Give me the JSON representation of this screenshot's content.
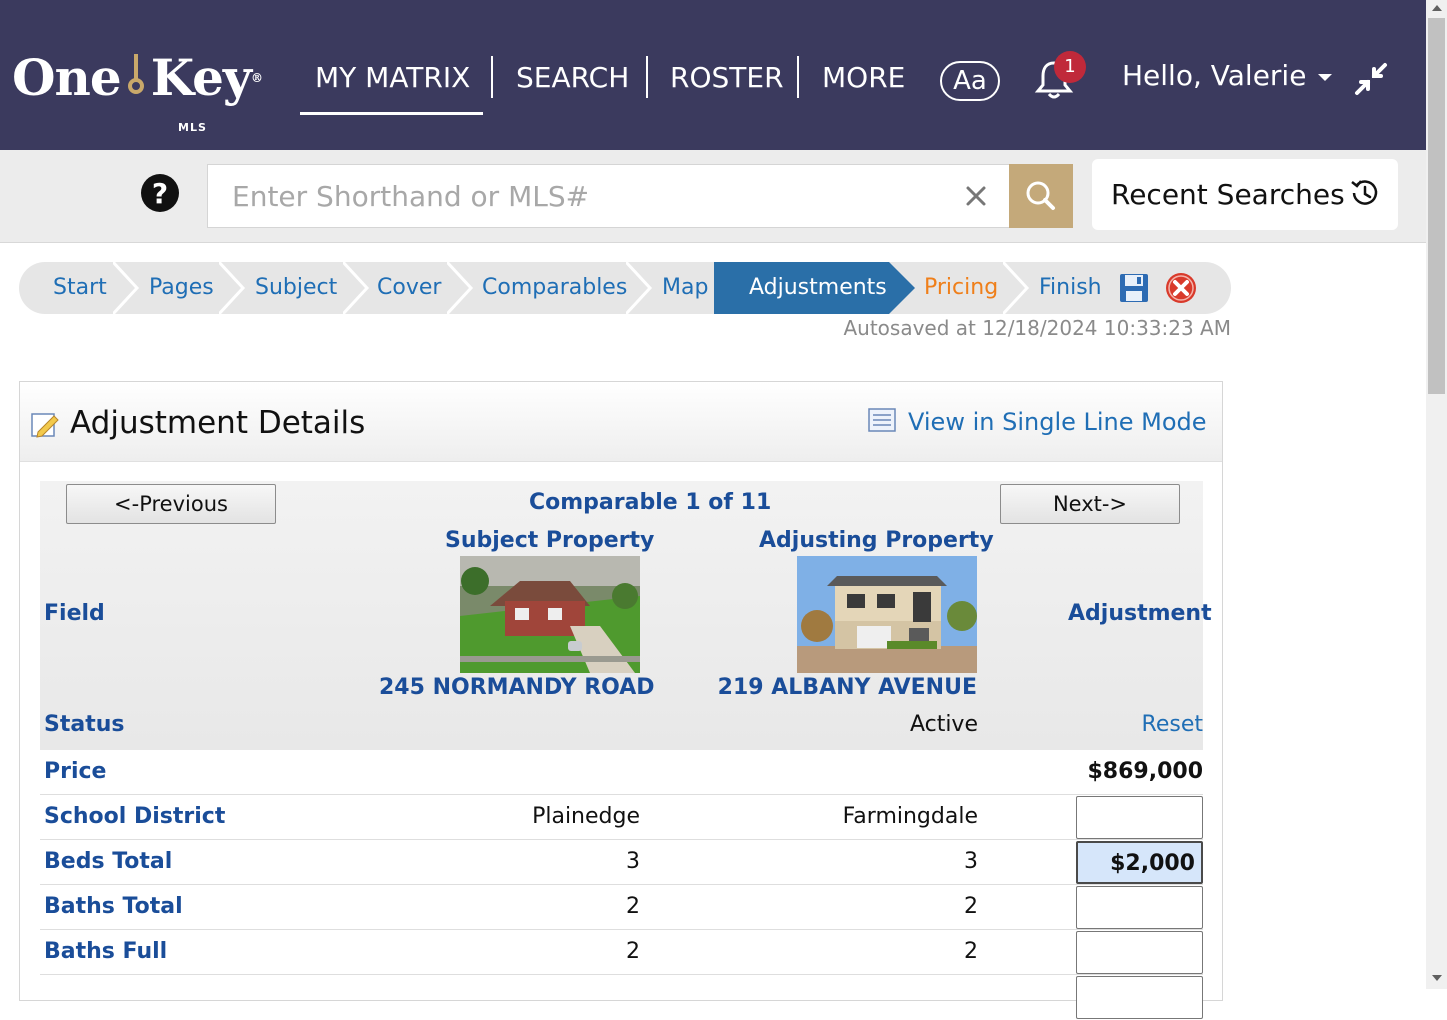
{
  "header": {
    "logo_text_left": "One",
    "logo_text_right": "Key",
    "logo_reg": "®",
    "logo_sub": "MLS",
    "nav": [
      "MY MATRIX",
      "SEARCH",
      "ROSTER",
      "MORE"
    ],
    "font_button": "Aa",
    "notification_count": "1",
    "greeting": "Hello, Valerie",
    "icons": [
      "bell-icon",
      "collapse-icon",
      "caret-down-icon"
    ]
  },
  "search": {
    "placeholder": "Enter Shorthand or MLS#",
    "value": "",
    "recent_label": "Recent Searches",
    "icons": [
      "help-icon",
      "clear-icon",
      "search-icon",
      "history-icon"
    ]
  },
  "wizard": {
    "steps": [
      "Start",
      "Pages",
      "Subject",
      "Cover",
      "Comparables",
      "Map",
      "Adjustments",
      "Pricing",
      "Finish"
    ],
    "active_step": "Adjustments",
    "autosave": "Autosaved at 12/18/2024 10:33:23 AM",
    "colors": {
      "active": "#2a6fa8",
      "pending": "#ef7f1a",
      "link": "#1f6eb5"
    }
  },
  "panel": {
    "title": "Adjustment Details",
    "single_line_link": "View in Single Line Mode",
    "prev_label": "<-Previous",
    "next_label": "Next->",
    "comparable_counter": "Comparable 1 of 11",
    "subject_heading": "Subject Property",
    "adjusting_heading": "Adjusting Property",
    "field_heading": "Field",
    "adjustment_heading": "Adjustment",
    "subject_address": "245 NORMANDY ROAD",
    "adjusting_address": "219 ALBANY AVENUE",
    "status_label": "Status",
    "status_value": "Active",
    "reset_label": "Reset",
    "price_label": "Price",
    "price_value": "$869,000"
  },
  "rows": [
    {
      "field": "School District",
      "subject": "Plainedge",
      "comparable": "Farmingdale",
      "adjustment": ""
    },
    {
      "field": "Beds Total",
      "subject": "3",
      "comparable": "3",
      "adjustment": "$2,000"
    },
    {
      "field": "Baths Total",
      "subject": "2",
      "comparable": "2",
      "adjustment": ""
    },
    {
      "field": "Baths Full",
      "subject": "2",
      "comparable": "2",
      "adjustment": ""
    }
  ]
}
